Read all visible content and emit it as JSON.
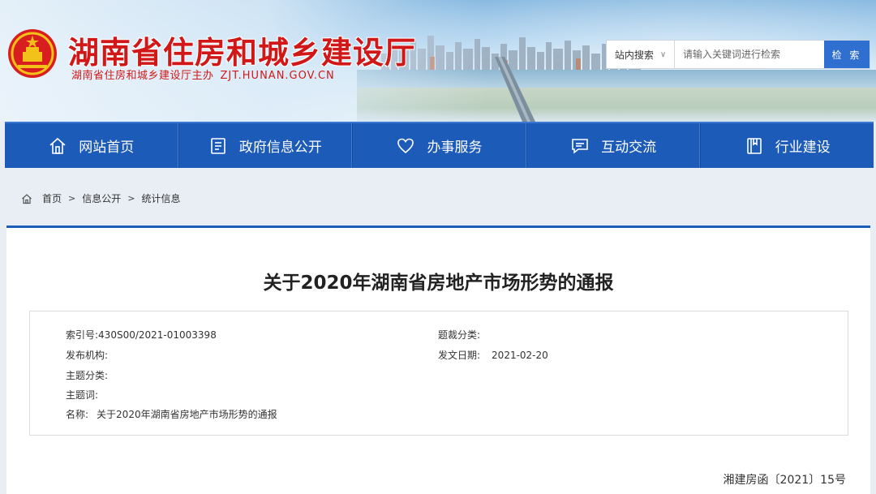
{
  "header": {
    "title": "湖南省住房和城乡建设厅",
    "subtitle": "湖南省住房和城乡建设厅主办",
    "domain": "ZJT.HUNAN.GOV.CN",
    "emblem_icon": "national-emblem-icon"
  },
  "search": {
    "scope": "站内搜索",
    "placeholder": "请输入关键词进行检索",
    "button_label": "检 索"
  },
  "nav": {
    "items": [
      {
        "label": "网站首页",
        "icon": "home-icon"
      },
      {
        "label": "政府信息公开",
        "icon": "document-icon"
      },
      {
        "label": "办事服务",
        "icon": "heart-icon"
      },
      {
        "label": "互动交流",
        "icon": "chat-icon"
      },
      {
        "label": "行业建设",
        "icon": "book-icon"
      }
    ]
  },
  "breadcrumb": {
    "items": [
      "首页",
      "信息公开",
      "统计信息"
    ],
    "separator": ">"
  },
  "article": {
    "title": "关于2020年湖南省房地产市场形势的通报",
    "doc_number": "湘建房函〔2021〕15号"
  },
  "meta": {
    "index_label": "索引号:",
    "index_value": "430S00/2021-01003398",
    "category_label": "题裁分类:",
    "category_value": "",
    "publisher_label": "发布机构:",
    "publisher_value": "",
    "date_label": "发文日期:",
    "date_value": "2021-02-20",
    "topic_label": "主题分类:",
    "topic_value": "",
    "keywords_label": "主题词:",
    "keywords_value": "",
    "name_label": "名称:",
    "name_value": "关于2020年湖南省房地产市场形势的通报"
  },
  "colors": {
    "nav_blue": "#1d5bb8",
    "title_red": "#d01818",
    "search_blue": "#2f6fd0"
  }
}
